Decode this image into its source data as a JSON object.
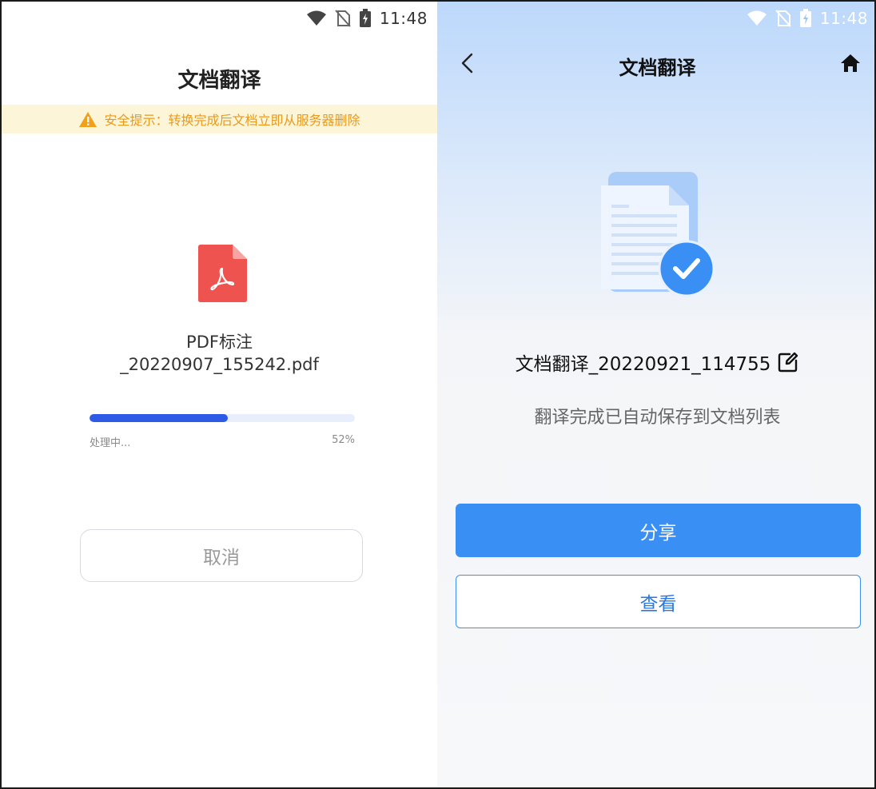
{
  "status_bar": {
    "time": "11:48"
  },
  "left_screen": {
    "title": "文档翻译",
    "security_notice": "安全提示：转换完成后文档立即从服务器删除",
    "file": {
      "icon": "pdf-file-icon",
      "name_line1": "PDF标注",
      "name_line2": "_20220907_155242.pdf"
    },
    "progress": {
      "label": "处理中...",
      "percent_text": "52%",
      "value": 0.52
    },
    "cancel_label": "取消",
    "colors": {
      "accent": "#2e5be6",
      "warning": "#e89a1c",
      "pdf_red": "#ee5350"
    }
  },
  "right_screen": {
    "title": "文档翻译",
    "icons": {
      "back": "back-chevron-icon",
      "home": "home-icon",
      "edit": "edit-icon",
      "done": "check-circle-icon"
    },
    "document_name": "文档翻译_20220921_114755",
    "save_message": "翻译完成已自动保存到文档列表",
    "share_label": "分享",
    "view_label": "查看",
    "colors": {
      "primary": "#3a8ff5"
    }
  }
}
